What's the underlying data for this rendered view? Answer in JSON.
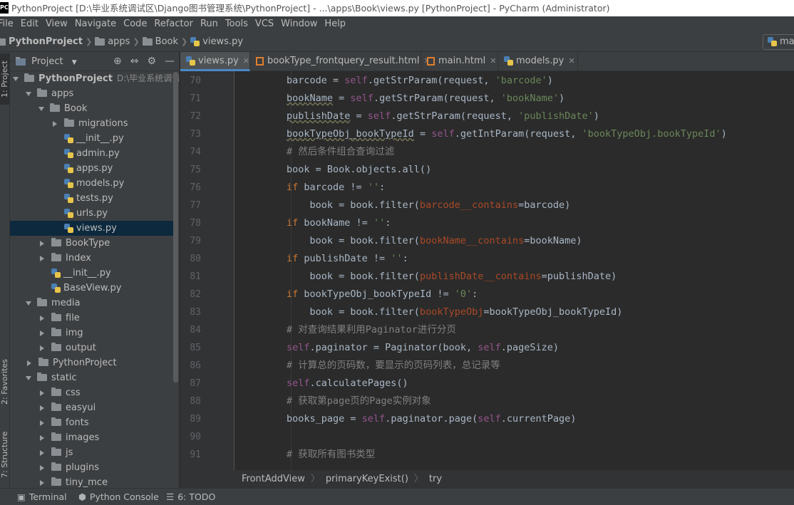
{
  "window": {
    "title": "PythonProject [D:\\毕业系统调试区\\Django图书管理系统\\PythonProject] - ...\\apps\\Book\\views.py [PythonProject] - PyCharm (Administrator)",
    "app_icon_label": "PC"
  },
  "menu": [
    "File",
    "Edit",
    "View",
    "Navigate",
    "Code",
    "Refactor",
    "Run",
    "Tools",
    "VCS",
    "Window",
    "Help"
  ],
  "navbar": {
    "crumbs": [
      "PythonProject",
      "apps",
      "Book",
      "views.py"
    ],
    "run_config_label": "mar"
  },
  "stripe": {
    "project_tab": "1: Project",
    "favorites_tab": "2: Favorites",
    "structure_tab": "7: Structure"
  },
  "project_panel": {
    "header": "Project",
    "tree": [
      {
        "label": "PythonProject",
        "extra": "D:\\毕业系统调试区\\",
        "expanded": true,
        "bold": true
      },
      {
        "label": "apps",
        "expanded": true
      },
      {
        "label": "Book",
        "expanded": true
      },
      {
        "label": "migrations",
        "expanded": false
      },
      {
        "label": "__init__.py"
      },
      {
        "label": "admin.py"
      },
      {
        "label": "apps.py"
      },
      {
        "label": "models.py"
      },
      {
        "label": "tests.py"
      },
      {
        "label": "urls.py"
      },
      {
        "label": "views.py",
        "selected": true
      },
      {
        "label": "BookType",
        "expanded": false
      },
      {
        "label": "Index",
        "expanded": false
      },
      {
        "label": "__init__.py"
      },
      {
        "label": "BaseView.py"
      },
      {
        "label": "media",
        "expanded": true
      },
      {
        "label": "file",
        "expanded": false
      },
      {
        "label": "img",
        "expanded": false
      },
      {
        "label": "output",
        "expanded": false
      },
      {
        "label": "PythonProject",
        "expanded": false
      },
      {
        "label": "static",
        "expanded": true
      },
      {
        "label": "css",
        "expanded": false
      },
      {
        "label": "easyui",
        "expanded": false
      },
      {
        "label": "fonts",
        "expanded": false
      },
      {
        "label": "images",
        "expanded": false
      },
      {
        "label": "js",
        "expanded": false
      },
      {
        "label": "plugins",
        "expanded": false
      },
      {
        "label": "tiny_mce",
        "expanded": false
      }
    ]
  },
  "editor_tabs": [
    {
      "label": "views.py",
      "active": true,
      "icon": "python-file-icon"
    },
    {
      "label": "bookType_frontquery_result.html",
      "active": false,
      "icon": "html-file-icon"
    },
    {
      "label": "main.html",
      "active": false,
      "icon": "html-file-icon"
    },
    {
      "label": "models.py",
      "active": false,
      "icon": "python-file-icon"
    }
  ],
  "code": {
    "line_numbers": [
      "70",
      "71",
      "72",
      "73",
      "74",
      "75",
      "76",
      "77",
      "78",
      "79",
      "80",
      "81",
      "82",
      "83",
      "84",
      "85",
      "86",
      "87",
      "88",
      "89",
      "90",
      "91"
    ],
    "lines": [
      "barcode = self.getStrParam(request, 'barcode')",
      "bookName = self.getStrParam(request, 'bookName')",
      "publishDate = self.getStrParam(request, 'publishDate')",
      "bookTypeObj_bookTypeId = self.getIntParam(request, 'bookTypeObj.bookTypeId')",
      "# 然后条件组合查询过滤",
      "book = Book.objects.all()",
      "if barcode != '':",
      "    book = book.filter(barcode__contains=barcode)",
      "if bookName != '':",
      "    book = book.filter(bookName__contains=bookName)",
      "if publishDate != '':",
      "    book = book.filter(publishDate__contains=publishDate)",
      "if bookTypeObj_bookTypeId != '0':",
      "    book = book.filter(bookTypeObj=bookTypeObj_bookTypeId)",
      "# 对查询结果利用Paginator进行分页",
      "self.paginator = Paginator(book, self.pageSize)",
      "# 计算总的页码数，要显示的页码列表，总记录等",
      "self.calculatePages()",
      "# 获取第page页的Page实例对象",
      "books_page = self.paginator.page(self.currentPage)",
      "",
      "# 获取所有图书类型"
    ]
  },
  "breadcrumb": [
    "FrontAddView",
    "primaryKeyExist()",
    "try"
  ],
  "bottom_tools": [
    {
      "label": "Terminal",
      "icon": "terminal-icon"
    },
    {
      "label": "Python Console",
      "icon": "python-console-icon"
    },
    {
      "label": "6: TODO",
      "icon": "todo-icon"
    }
  ],
  "colors": {
    "keyword": "#cc7832",
    "self": "#94558d",
    "string": "#6a8759",
    "comment": "#808080",
    "parameter": "#aa4926",
    "selection": "#0d293e",
    "tab_accent": "#4a88c7"
  }
}
